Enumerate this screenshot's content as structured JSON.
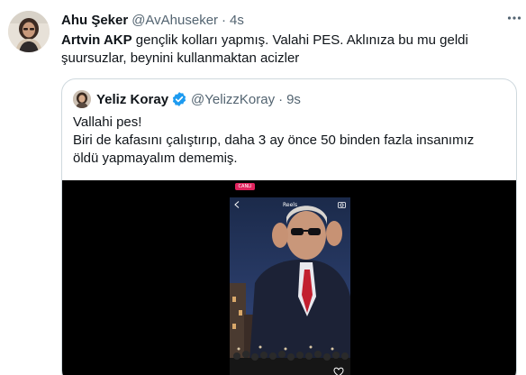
{
  "tweet": {
    "author_name": "Ahu Şeker",
    "author_handle": "@AvAhuseker",
    "separator": "·",
    "time": "4s",
    "text_bold": "Artvin AKP",
    "text_rest_line1": " gençlik kolları yapmış. Valahi PES. Aklınıza bu mu geldi",
    "text_line2": "şuursuzlar, beynini kullanmaktan acizler"
  },
  "quote": {
    "author_name": "Yeliz Koray",
    "author_handle": "@YelizzKoray",
    "separator": "·",
    "time": "9s",
    "lines": [
      "Vallahi pes!",
      "Biri de kafasını çalıştırıp, daha 3 ay önce 50 binden fazla insanımız",
      "öldü yapmayalım dememiş."
    ],
    "media": {
      "live_badge": "CANLI",
      "reels_label": "Reels"
    }
  },
  "icons": {
    "more": "more-horizontal-icon",
    "verified": "verified-badge-icon",
    "back": "chevron-left-icon",
    "camera": "camera-icon"
  },
  "colors": {
    "text_primary": "#0f1419",
    "text_secondary": "#536471",
    "border": "#cfd9de",
    "verified_blue": "#1d9bf0"
  }
}
